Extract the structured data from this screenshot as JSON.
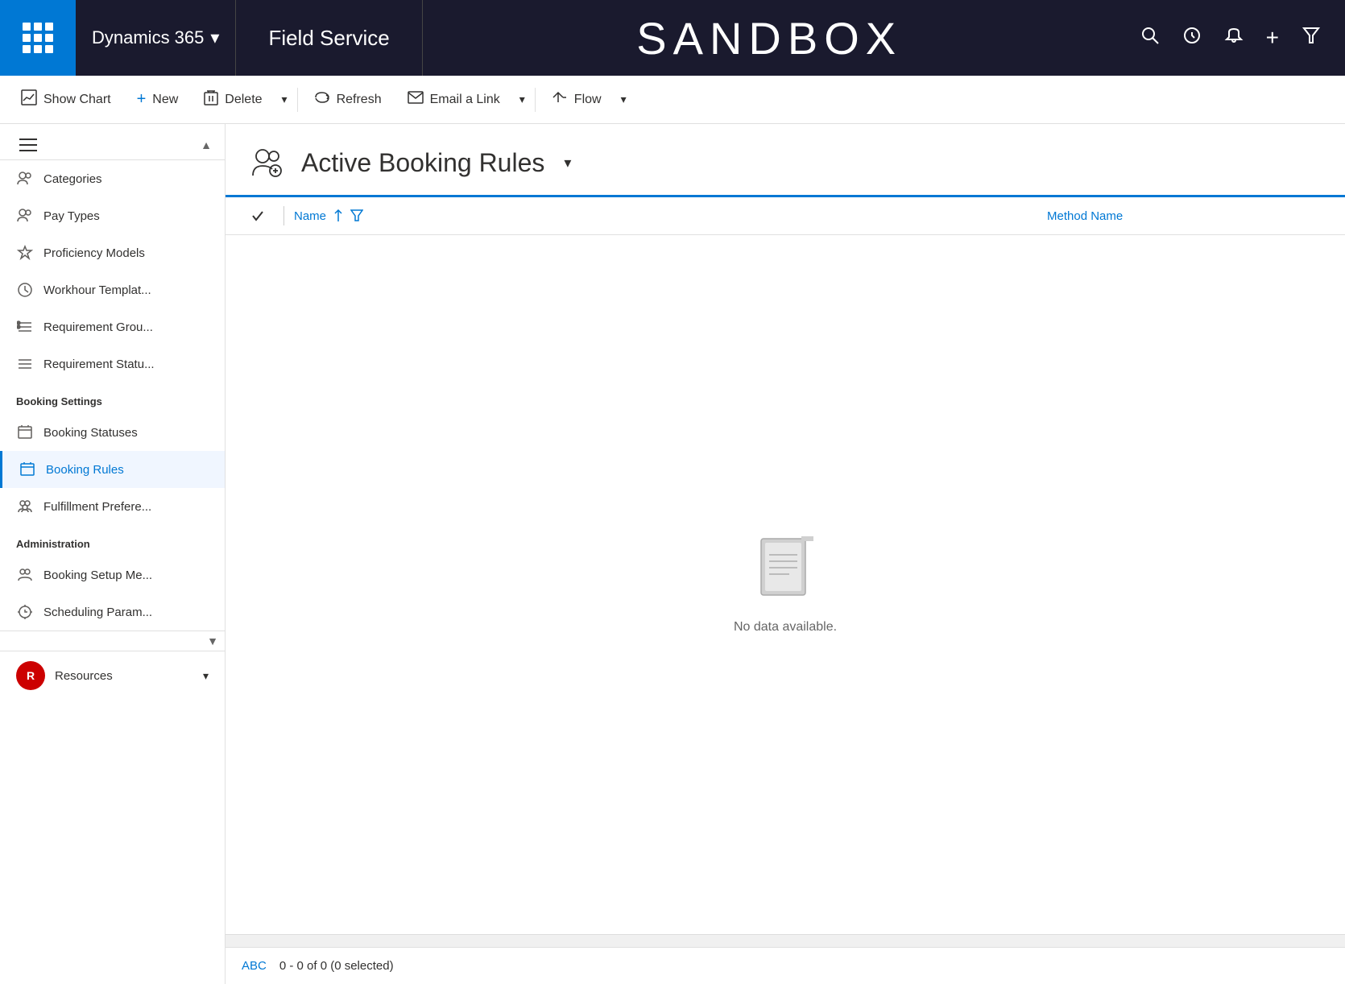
{
  "topNav": {
    "appName": "Dynamics 365",
    "appNameChevron": "▾",
    "fieldService": "Field Service",
    "sandbox": "SANDBOX"
  },
  "toolbar": {
    "showChart": "Show Chart",
    "new": "New",
    "delete": "Delete",
    "refresh": "Refresh",
    "emailALink": "Email a Link",
    "flow": "Flow"
  },
  "sidebar": {
    "hamburgerTitle": "≡",
    "items": [
      {
        "label": "Categories",
        "icon": "👤"
      },
      {
        "label": "Pay Types",
        "icon": "👤"
      },
      {
        "label": "Proficiency Models",
        "icon": "☆"
      },
      {
        "label": "Workhour Templat...",
        "icon": "⊙"
      },
      {
        "label": "Requirement Grou...",
        "icon": "≡"
      },
      {
        "label": "Requirement Statu...",
        "icon": "≡"
      }
    ],
    "bookingSettingsHeader": "Booking Settings",
    "bookingSettingsItems": [
      {
        "label": "Booking Statuses",
        "icon": "⊞"
      },
      {
        "label": "Booking Rules",
        "icon": "⊞",
        "active": true
      },
      {
        "label": "Fulfillment Prefere...",
        "icon": "👥"
      }
    ],
    "administrationHeader": "Administration",
    "administrationItems": [
      {
        "label": "Booking Setup Me...",
        "icon": "👥"
      },
      {
        "label": "Scheduling Param...",
        "icon": "⚙"
      }
    ],
    "footer": {
      "avatarLabel": "R",
      "name": "Resources"
    }
  },
  "page": {
    "title": "Active Booking Rules",
    "columns": {
      "name": "Name",
      "methodName": "Method Name"
    },
    "emptyState": "No data available.",
    "pagination": {
      "abc": "ABC",
      "info": "0 - 0 of 0 (0 selected)"
    }
  }
}
